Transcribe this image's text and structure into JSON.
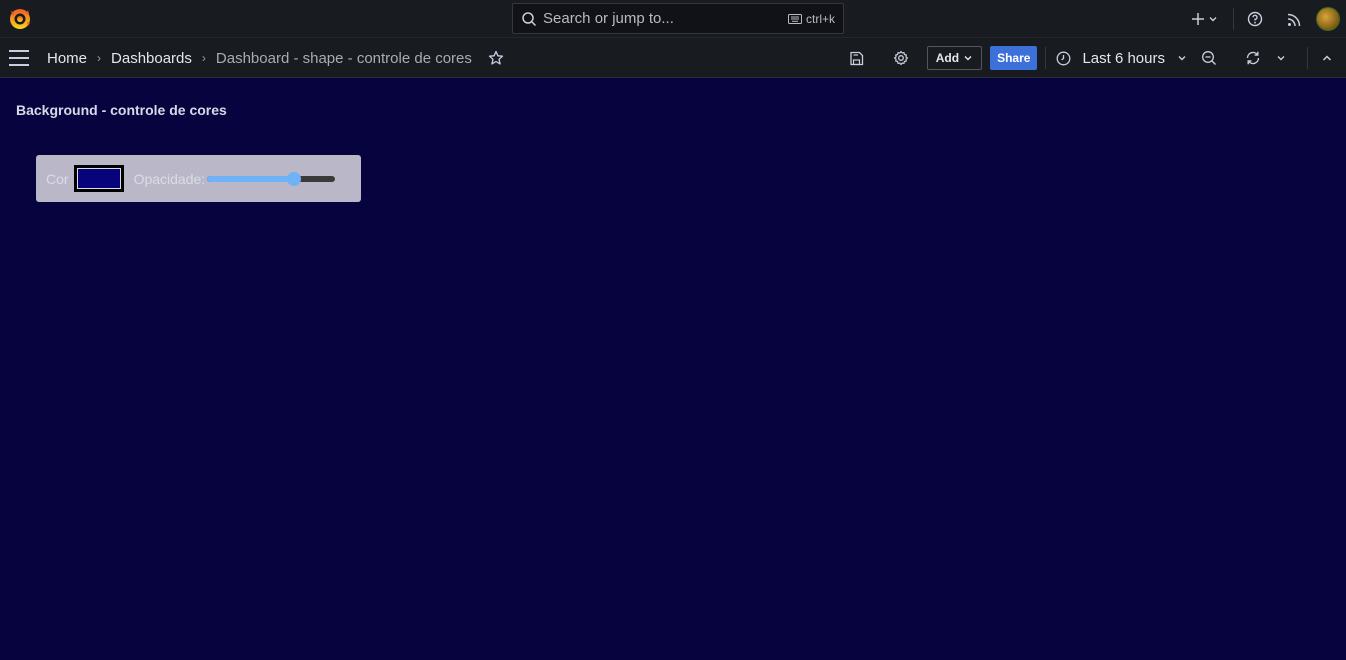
{
  "topbar": {
    "search_placeholder": "Search or jump to...",
    "shortcut": "ctrl+k"
  },
  "breadcrumb": {
    "home": "Home",
    "dashboards": "Dashboards",
    "current": "Dashboard - shape - controle de cores"
  },
  "toolbar": {
    "add_label": "Add",
    "share_label": "Share",
    "time_range": "Last 6 hours"
  },
  "panel": {
    "title": "Background - controle de cores",
    "color_label": "Cor",
    "color_value": "#07037a",
    "opacity_label": "Opacidade:",
    "opacity_value": 0.68
  },
  "colors": {
    "background": "#07033f",
    "share_button": "#3d71d9",
    "slider": "#6fb2f5"
  }
}
